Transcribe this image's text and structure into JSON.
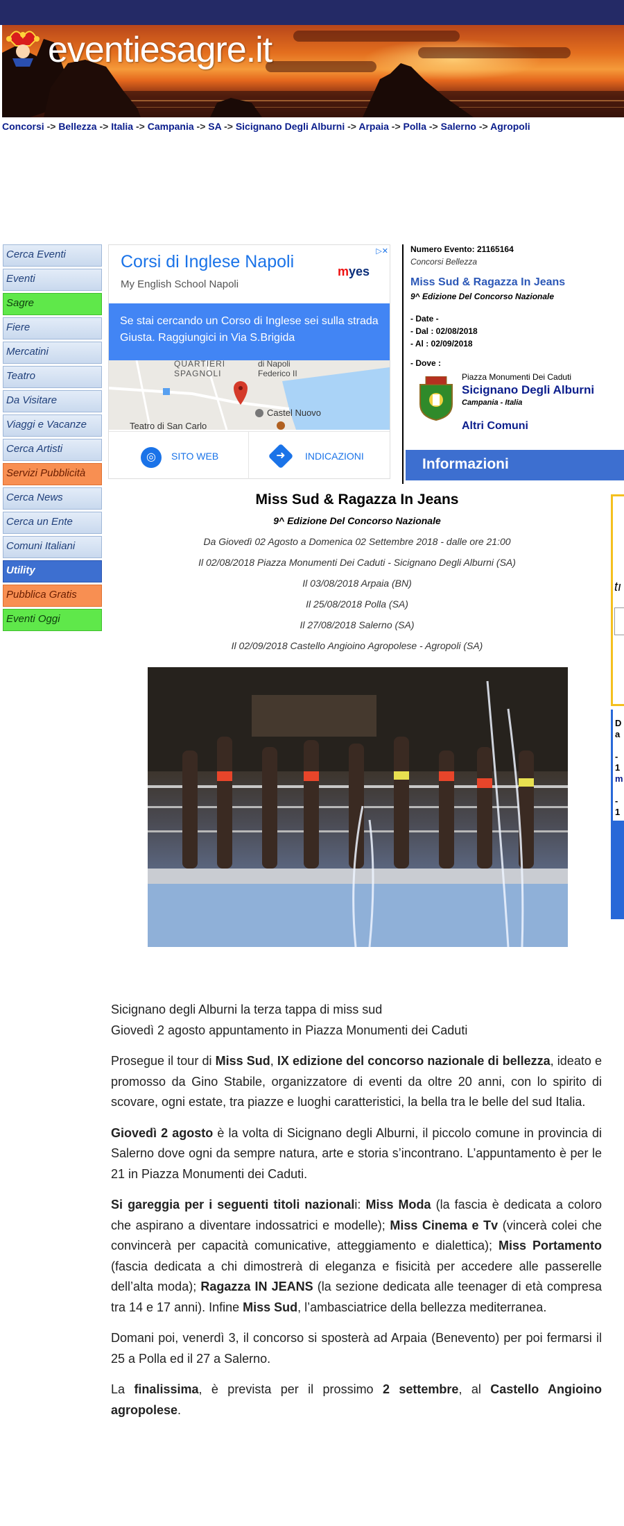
{
  "site": {
    "logo_text": "eventiesagre.it"
  },
  "breadcrumb": [
    "Concorsi",
    "Bellezza",
    "Italia",
    "Campania",
    "SA",
    "Sicignano Degli Alburni",
    "Arpaia",
    "Polla",
    "Salerno",
    "Agropoli"
  ],
  "breadcrumb_sep": "->",
  "menu": [
    {
      "label": "Cerca Eventi",
      "style": "default"
    },
    {
      "label": "Eventi",
      "style": "default"
    },
    {
      "label": "Sagre",
      "style": "green"
    },
    {
      "label": "Fiere",
      "style": "default"
    },
    {
      "label": "Mercatini",
      "style": "default"
    },
    {
      "label": "Teatro",
      "style": "default"
    },
    {
      "label": "Da Visitare",
      "style": "default"
    },
    {
      "label": "Viaggi e Vacanze",
      "style": "default"
    },
    {
      "label": "Cerca Artisti",
      "style": "default"
    },
    {
      "label": "Servizi Pubblicità",
      "style": "orange"
    },
    {
      "label": "Cerca News",
      "style": "default"
    },
    {
      "label": "Cerca un Ente",
      "style": "default"
    },
    {
      "label": "Comuni Italiani",
      "style": "default"
    },
    {
      "label": "Utility",
      "style": "blue"
    },
    {
      "label": "Pubblica Gratis",
      "style": "orange"
    },
    {
      "label": "Eventi Oggi",
      "style": "green"
    }
  ],
  "ad": {
    "title": "Corsi di Inglese Napoli",
    "subtitle": "My English School Napoli",
    "brand": "mes",
    "text": "Se stai cercando un Corso di Inglese sei sulla strada Giusta. Raggiungici in Via S.Brigida",
    "map_labels": [
      "QUARTIERI",
      "SPAGNOLI",
      "di Napoli",
      "Federico II",
      "Castel Nuovo",
      "Teatro di San Carlo"
    ],
    "btn_site": "SITO WEB",
    "btn_dir": "INDICAZIONI"
  },
  "info": {
    "number_label": "Numero Evento: 21165164",
    "category": "Concorsi Bellezza",
    "title": "Miss Sud & Ragazza In Jeans",
    "edition": "9^ Edizione Del Concorso Nazionale",
    "date_label": "- Date -",
    "dal": "- Dal : 02/08/2018",
    "al": "- Al : 02/09/2018",
    "dove_label": "- Dove :",
    "place": "Piazza Monumenti Dei Caduti",
    "town": "Sicignano Degli Alburni",
    "region": "Campania - Italia",
    "altri": "Altri Comuni",
    "bar": "Informazioni"
  },
  "event": {
    "title": "Miss Sud & Ragazza In Jeans",
    "subtitle": "9^ Edizione Del Concorso Nazionale",
    "lines": [
      "Da Giovedì 02 Agosto a Domenica 02 Settembre 2018 - dalle ore 21:00",
      "Il 02/08/2018 Piazza Monumenti Dei Caduti - Sicignano Degli Alburni (SA)",
      "Il 03/08/2018 Arpaia (BN)",
      "Il 25/08/2018 Polla (SA)",
      "Il 27/08/2018 Salerno (SA)",
      "Il 02/09/2018 Castello Angioino Agropolese - Agropoli (SA)"
    ]
  },
  "article": {
    "intro1": "Sicignano degli Alburni la terza tappa di miss sud",
    "intro2": "Giovedì 2 agosto appuntamento in Piazza Monumenti dei Caduti",
    "p1": [
      {
        "t": "Prosegue il tour di ",
        "b": false
      },
      {
        "t": "Miss Sud",
        "b": true
      },
      {
        "t": ", ",
        "b": false
      },
      {
        "t": "IX edizione del concorso nazionale di bellezza",
        "b": true
      },
      {
        "t": ", ideato e promosso da Gino Stabile, organizzatore di eventi da oltre 20 anni, con lo spirito di scovare, ogni estate, tra piazze e luoghi caratteristici, la bella tra le belle del sud Italia.",
        "b": false
      }
    ],
    "p2": [
      {
        "t": "Giovedì 2 agosto",
        "b": true
      },
      {
        "t": " è la volta di Sicignano degli Alburni, il piccolo comune in provincia di Salerno dove ogni da sempre natura, arte e storia s’incontrano. L’appuntamento è per le 21 in Piazza Monumenti dei Caduti.",
        "b": false
      }
    ],
    "p3": [
      {
        "t": "Si gareggia per i seguenti titoli nazional",
        "b": true
      },
      {
        "t": "i: ",
        "b": false
      },
      {
        "t": "Miss Moda",
        "b": true
      },
      {
        "t": " (la fascia è dedicata a coloro che aspirano a diventare indossatrici e modelle); ",
        "b": false
      },
      {
        "t": "Miss Cinema e Tv",
        "b": true
      },
      {
        "t": " (vincerà colei che convincerà per capacità comunicative, atteggiamento e dialettica); ",
        "b": false
      },
      {
        "t": "Miss Portamento",
        "b": true
      },
      {
        "t": " (fascia dedicata a chi dimostrerà di eleganza e fisicità per accedere alle passerelle dell’alta moda); ",
        "b": false
      },
      {
        "t": "Ragazza IN JEANS",
        "b": true
      },
      {
        "t": " (la sezione dedicata alle teenager di età compresa tra 14 e 17 anni). Infine ",
        "b": false
      },
      {
        "t": "Miss Sud",
        "b": true
      },
      {
        "t": ", l’ambasciatrice della bellezza mediterranea.",
        "b": false
      }
    ],
    "p4": [
      {
        "t": "Domani poi, venerdì 3, il concorso si sposterà ad Arpaia (Benevento) per poi fermarsi il 25 a Polla ed il 27 a Salerno.",
        "b": false
      }
    ],
    "p5": [
      {
        "t": "La ",
        "b": false
      },
      {
        "t": "finalissima",
        "b": true
      },
      {
        "t": ", è prevista per il prossimo ",
        "b": false
      },
      {
        "t": "2 settembre",
        "b": true
      },
      {
        "t": ", al ",
        "b": false
      },
      {
        "t": "Castello Angioino agropolese",
        "b": true
      },
      {
        "t": ".",
        "b": false
      }
    ]
  },
  "right_fragments": {
    "f1": "tı",
    "f2": [
      "D",
      "a",
      "- 1",
      "m",
      "- 1",
      "m"
    ]
  }
}
